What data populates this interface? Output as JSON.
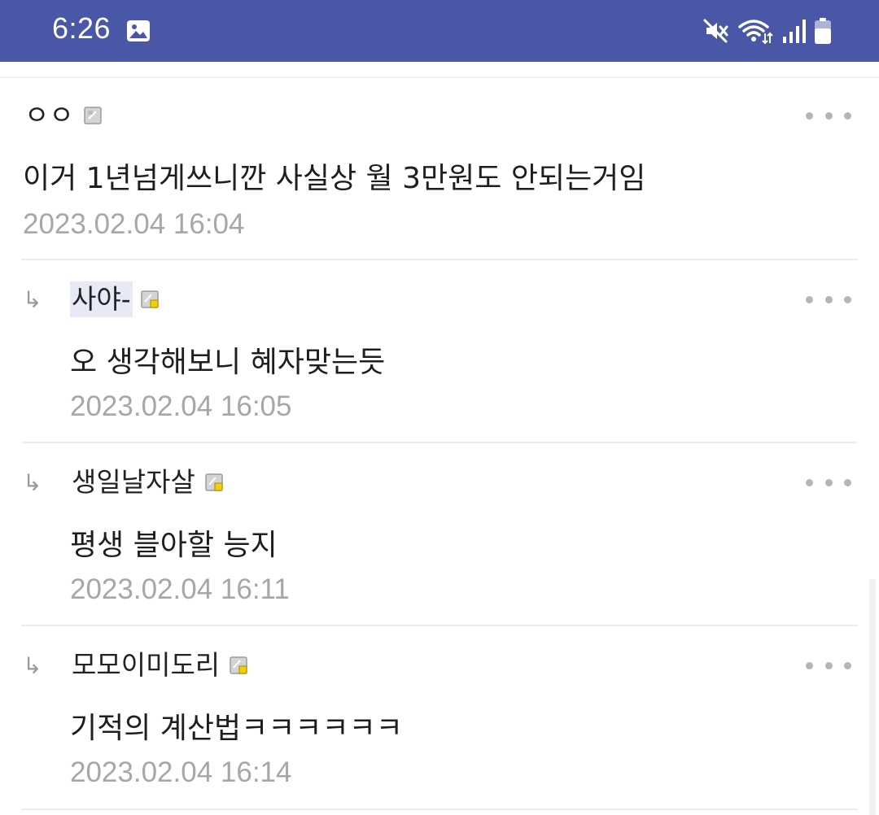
{
  "status_bar": {
    "time": "6:26",
    "left_icon": "gallery-icon",
    "right_icons": [
      "mute-icon",
      "wifi-icon",
      "signal-icon",
      "battery-icon"
    ],
    "background": "#4a56a6"
  },
  "comments": [
    {
      "author": "ㅇㅇ",
      "is_reply": false,
      "author_highlighted": false,
      "level_icon": "fixed-nick-icon",
      "body": "이거 1년넘게쓰니깐 사실상 월 3만원도 안되는거임",
      "date": "2023.02.04 16:04"
    },
    {
      "author": "사야-",
      "is_reply": true,
      "author_highlighted": true,
      "level_icon": "member-nick-icon",
      "body": "오 생각해보니 혜자맞는듯",
      "date": "2023.02.04 16:05"
    },
    {
      "author": "생일날자살",
      "is_reply": true,
      "author_highlighted": false,
      "level_icon": "member-nick-icon",
      "body": "평생 블아할 능지",
      "date": "2023.02.04 16:11"
    },
    {
      "author": "모모이미도리",
      "is_reply": true,
      "author_highlighted": false,
      "level_icon": "member-nick-icon",
      "body": "기적의 계산법ㅋㅋㅋㅋㅋㅋ",
      "date": "2023.02.04 16:14"
    }
  ],
  "reply_arrow": "↳"
}
